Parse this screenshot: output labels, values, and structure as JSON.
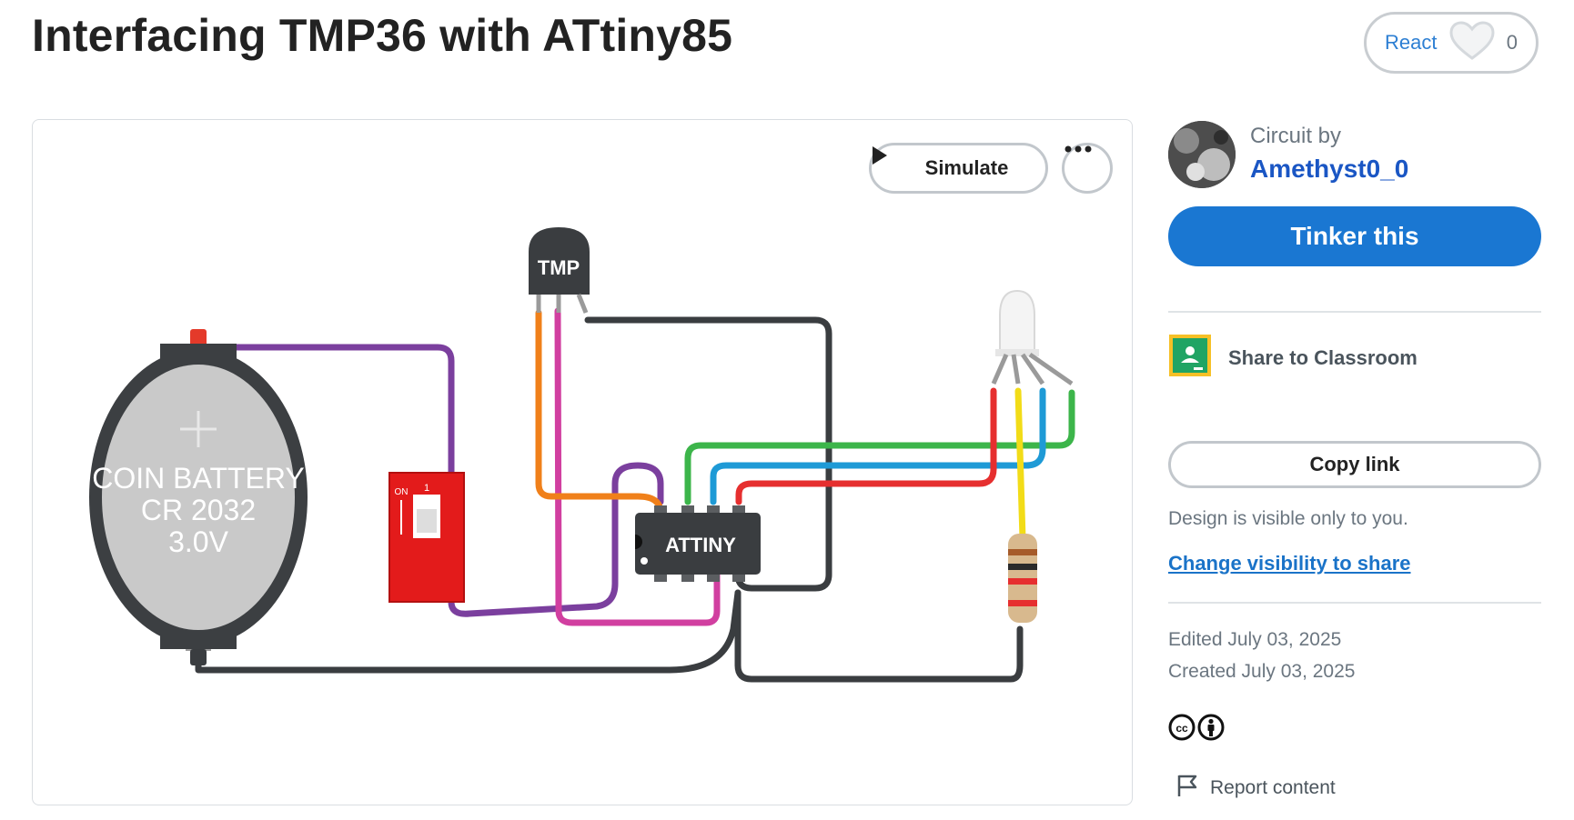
{
  "page": {
    "title": "Interfacing TMP36 with ATtiny85"
  },
  "react": {
    "label": "React",
    "count": "0",
    "icon": "heart-icon"
  },
  "canvas": {
    "simulate_label": "Simulate",
    "more_icon": "more-options-icon",
    "components": {
      "battery_line1": "COIN BATTERY",
      "battery_line2": "CR 2032",
      "battery_line3": "3.0V",
      "sensor_label": "TMP",
      "chip_label": "ATTINY",
      "switch_on": "ON",
      "switch_num": "1"
    }
  },
  "author": {
    "prefix": "Circuit by",
    "name": "Amethyst0_0"
  },
  "actions": {
    "tinker_label": "Tinker this",
    "classroom_label": "Share to Classroom",
    "copy_link_label": "Copy link"
  },
  "visibility": {
    "note": "Design is visible only to you.",
    "change_label": "Change visibility to share"
  },
  "dates": {
    "edited": "Edited July 03, 2025",
    "created": "Created July 03, 2025"
  },
  "license": {
    "icons": [
      "cc-icon",
      "attribution-icon"
    ]
  },
  "report": {
    "label": "Report content",
    "icon": "flag-icon"
  },
  "colors": {
    "accent_blue": "#1a77d2",
    "link_blue": "#1a56c4",
    "wire_purple": "#7b3f9e",
    "wire_pink": "#d13fa0",
    "wire_orange": "#f0801a",
    "wire_green": "#3cb54a",
    "wire_blue": "#1e9ad6",
    "wire_red": "#e62f2f",
    "wire_yellow": "#f2dc18",
    "wire_dark": "#3a3d40"
  }
}
